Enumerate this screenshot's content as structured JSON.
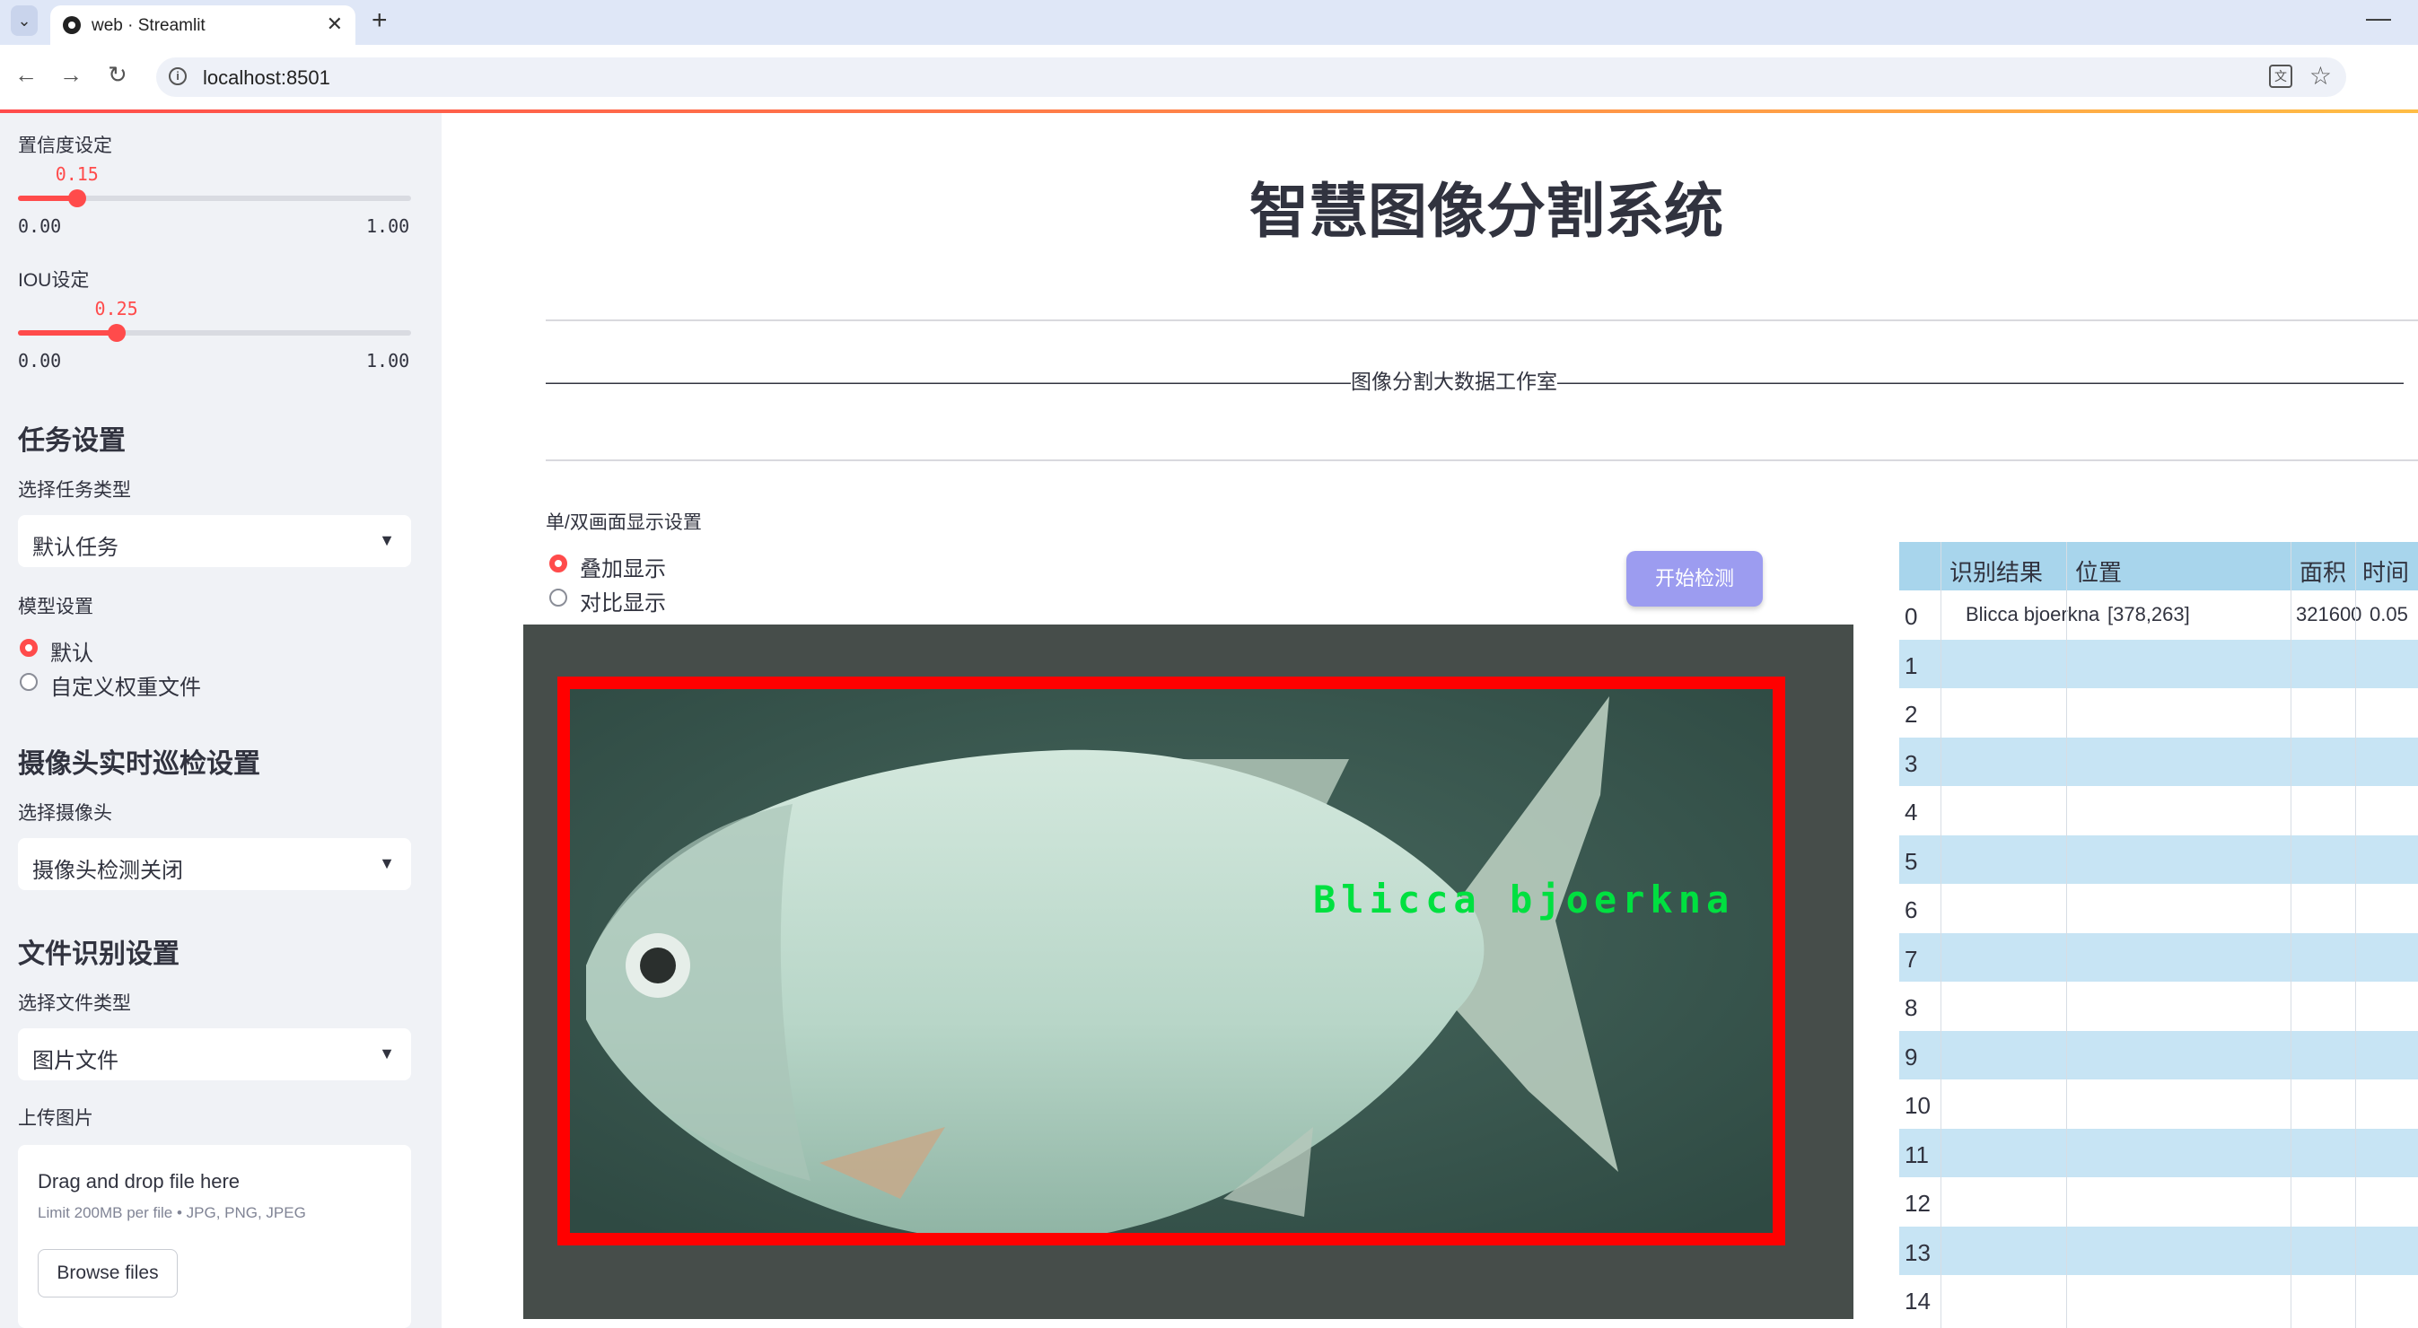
{
  "browser": {
    "tab_title": "web · Streamlit",
    "url": "localhost:8501"
  },
  "sidebar": {
    "confidence": {
      "label": "置信度设定",
      "value": "0.15",
      "fraction": 0.15,
      "min": "0.00",
      "max": "1.00"
    },
    "iou": {
      "label": "IOU设定",
      "value": "0.25",
      "fraction": 0.25,
      "min": "0.00",
      "max": "1.00"
    },
    "task_header": "任务设置",
    "task_type_label": "选择任务类型",
    "task_type_value": "默认任务",
    "model_label": "模型设置",
    "model_options": [
      "默认",
      "自定义权重文件"
    ],
    "model_selected": 0,
    "camera_header": "摄像头实时巡检设置",
    "camera_label": "选择摄像头",
    "camera_value": "摄像头检测关闭",
    "file_header": "文件识别设置",
    "file_type_label": "选择文件类型",
    "file_type_value": "图片文件",
    "upload_label": "上传图片",
    "upload_title": "Drag and drop file here",
    "upload_limit": "Limit 200MB per file • JPG, PNG, JPEG",
    "browse_label": "Browse files"
  },
  "main": {
    "title": "智慧图像分割系统",
    "divider_text": "———————————————————————————————————————图像分割大数据工作室—————————————————————————————————————————",
    "display_label": "单/双画面显示设置",
    "display_options": [
      "叠加显示",
      "对比显示"
    ],
    "display_selected": 0,
    "start_button": "开始检测",
    "detection_label": "Blicca  bjoerkna"
  },
  "table": {
    "columns": [
      "识别结果",
      "位置",
      "面积",
      "时间"
    ],
    "rows": [
      {
        "index": "0",
        "result": "Blicca bjoerkna",
        "position": "[378,263]",
        "area": "321600",
        "time": "0.05"
      },
      {
        "index": "1"
      },
      {
        "index": "2"
      },
      {
        "index": "3"
      },
      {
        "index": "4"
      },
      {
        "index": "5"
      },
      {
        "index": "6"
      },
      {
        "index": "7"
      },
      {
        "index": "8"
      },
      {
        "index": "9"
      },
      {
        "index": "10"
      },
      {
        "index": "11"
      },
      {
        "index": "12"
      },
      {
        "index": "13"
      },
      {
        "index": "14"
      }
    ]
  },
  "colors": {
    "accent": "#ff4b4b",
    "button": "#9c9cf0",
    "table_header": "#a8d5ec",
    "table_alt": "#c7e4f4",
    "box": "#ff0000",
    "label": "#00e040"
  }
}
